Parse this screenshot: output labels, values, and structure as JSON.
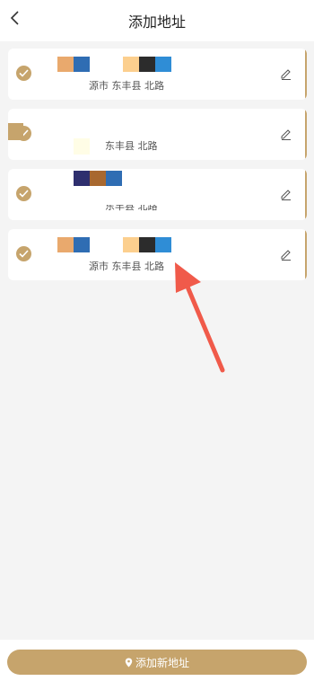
{
  "header": {
    "title": "添加地址",
    "back_icon": "chevron-left-icon"
  },
  "addresses": [
    {
      "address_text": "源市 东丰县 北路",
      "selected": true
    },
    {
      "address_text": "东丰县 北路",
      "selected": true
    },
    {
      "address_text": "东丰县 北路",
      "selected": true
    },
    {
      "address_text": "源市 东丰县 北路",
      "selected": true
    }
  ],
  "footer": {
    "add_button_label": "添加新地址",
    "add_button_icon": "location-pin-icon"
  },
  "colors": {
    "accent": "#c6a46c",
    "arrow": "#f05a4a"
  }
}
